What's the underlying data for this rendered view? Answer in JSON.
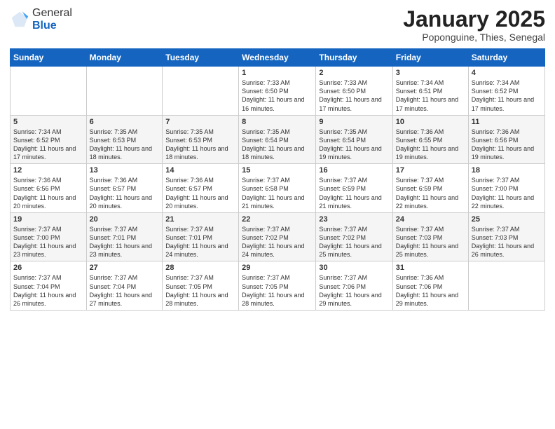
{
  "header": {
    "logo_line1": "General",
    "logo_line2": "Blue",
    "month": "January 2025",
    "location": "Poponguine, Thies, Senegal"
  },
  "weekdays": [
    "Sunday",
    "Monday",
    "Tuesday",
    "Wednesday",
    "Thursday",
    "Friday",
    "Saturday"
  ],
  "weeks": [
    [
      {
        "day": "",
        "content": ""
      },
      {
        "day": "",
        "content": ""
      },
      {
        "day": "",
        "content": ""
      },
      {
        "day": "1",
        "content": "Sunrise: 7:33 AM\nSunset: 6:50 PM\nDaylight: 11 hours and 16 minutes."
      },
      {
        "day": "2",
        "content": "Sunrise: 7:33 AM\nSunset: 6:50 PM\nDaylight: 11 hours and 17 minutes."
      },
      {
        "day": "3",
        "content": "Sunrise: 7:34 AM\nSunset: 6:51 PM\nDaylight: 11 hours and 17 minutes."
      },
      {
        "day": "4",
        "content": "Sunrise: 7:34 AM\nSunset: 6:52 PM\nDaylight: 11 hours and 17 minutes."
      }
    ],
    [
      {
        "day": "5",
        "content": "Sunrise: 7:34 AM\nSunset: 6:52 PM\nDaylight: 11 hours and 17 minutes."
      },
      {
        "day": "6",
        "content": "Sunrise: 7:35 AM\nSunset: 6:53 PM\nDaylight: 11 hours and 18 minutes."
      },
      {
        "day": "7",
        "content": "Sunrise: 7:35 AM\nSunset: 6:53 PM\nDaylight: 11 hours and 18 minutes."
      },
      {
        "day": "8",
        "content": "Sunrise: 7:35 AM\nSunset: 6:54 PM\nDaylight: 11 hours and 18 minutes."
      },
      {
        "day": "9",
        "content": "Sunrise: 7:35 AM\nSunset: 6:54 PM\nDaylight: 11 hours and 19 minutes."
      },
      {
        "day": "10",
        "content": "Sunrise: 7:36 AM\nSunset: 6:55 PM\nDaylight: 11 hours and 19 minutes."
      },
      {
        "day": "11",
        "content": "Sunrise: 7:36 AM\nSunset: 6:56 PM\nDaylight: 11 hours and 19 minutes."
      }
    ],
    [
      {
        "day": "12",
        "content": "Sunrise: 7:36 AM\nSunset: 6:56 PM\nDaylight: 11 hours and 20 minutes."
      },
      {
        "day": "13",
        "content": "Sunrise: 7:36 AM\nSunset: 6:57 PM\nDaylight: 11 hours and 20 minutes."
      },
      {
        "day": "14",
        "content": "Sunrise: 7:36 AM\nSunset: 6:57 PM\nDaylight: 11 hours and 20 minutes."
      },
      {
        "day": "15",
        "content": "Sunrise: 7:37 AM\nSunset: 6:58 PM\nDaylight: 11 hours and 21 minutes."
      },
      {
        "day": "16",
        "content": "Sunrise: 7:37 AM\nSunset: 6:59 PM\nDaylight: 11 hours and 21 minutes."
      },
      {
        "day": "17",
        "content": "Sunrise: 7:37 AM\nSunset: 6:59 PM\nDaylight: 11 hours and 22 minutes."
      },
      {
        "day": "18",
        "content": "Sunrise: 7:37 AM\nSunset: 7:00 PM\nDaylight: 11 hours and 22 minutes."
      }
    ],
    [
      {
        "day": "19",
        "content": "Sunrise: 7:37 AM\nSunset: 7:00 PM\nDaylight: 11 hours and 23 minutes."
      },
      {
        "day": "20",
        "content": "Sunrise: 7:37 AM\nSunset: 7:01 PM\nDaylight: 11 hours and 23 minutes."
      },
      {
        "day": "21",
        "content": "Sunrise: 7:37 AM\nSunset: 7:01 PM\nDaylight: 11 hours and 24 minutes."
      },
      {
        "day": "22",
        "content": "Sunrise: 7:37 AM\nSunset: 7:02 PM\nDaylight: 11 hours and 24 minutes."
      },
      {
        "day": "23",
        "content": "Sunrise: 7:37 AM\nSunset: 7:02 PM\nDaylight: 11 hours and 25 minutes."
      },
      {
        "day": "24",
        "content": "Sunrise: 7:37 AM\nSunset: 7:03 PM\nDaylight: 11 hours and 25 minutes."
      },
      {
        "day": "25",
        "content": "Sunrise: 7:37 AM\nSunset: 7:03 PM\nDaylight: 11 hours and 26 minutes."
      }
    ],
    [
      {
        "day": "26",
        "content": "Sunrise: 7:37 AM\nSunset: 7:04 PM\nDaylight: 11 hours and 26 minutes."
      },
      {
        "day": "27",
        "content": "Sunrise: 7:37 AM\nSunset: 7:04 PM\nDaylight: 11 hours and 27 minutes."
      },
      {
        "day": "28",
        "content": "Sunrise: 7:37 AM\nSunset: 7:05 PM\nDaylight: 11 hours and 28 minutes."
      },
      {
        "day": "29",
        "content": "Sunrise: 7:37 AM\nSunset: 7:05 PM\nDaylight: 11 hours and 28 minutes."
      },
      {
        "day": "30",
        "content": "Sunrise: 7:37 AM\nSunset: 7:06 PM\nDaylight: 11 hours and 29 minutes."
      },
      {
        "day": "31",
        "content": "Sunrise: 7:36 AM\nSunset: 7:06 PM\nDaylight: 11 hours and 29 minutes."
      },
      {
        "day": "",
        "content": ""
      }
    ]
  ]
}
